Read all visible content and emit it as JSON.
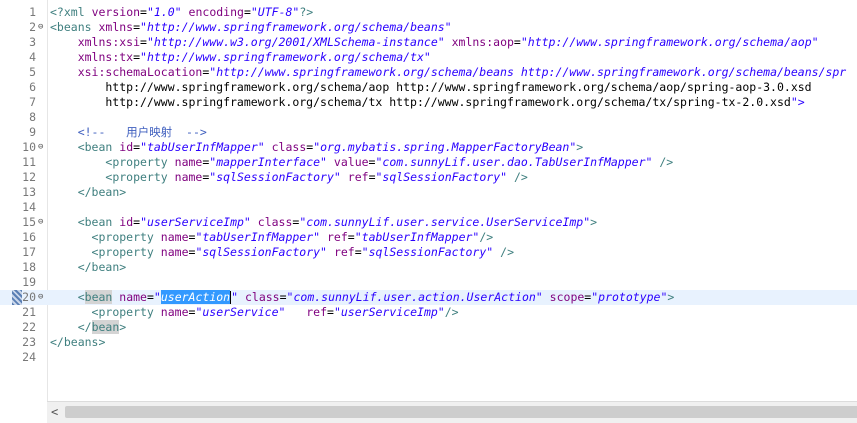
{
  "lines": [
    {
      "n": "1",
      "fold": "",
      "text": "<?xml version=\"1.0\" encoding=\"UTF-8\"?>"
    },
    {
      "n": "2",
      "fold": "⊖",
      "text": "<beans xmlns=\"http://www.springframework.org/schema/beans\""
    },
    {
      "n": "3",
      "fold": "",
      "text": "    xmlns:xsi=\"http://www.w3.org/2001/XMLSchema-instance\" xmlns:aop=\"http://www.springframework.org/schema/aop\""
    },
    {
      "n": "4",
      "fold": "",
      "text": "    xmlns:tx=\"http://www.springframework.org/schema/tx\""
    },
    {
      "n": "5",
      "fold": "",
      "text": "    xsi:schemaLocation=\"http://www.springframework.org/schema/beans http://www.springframework.org/schema/beans/spr"
    },
    {
      "n": "6",
      "fold": "",
      "text": "        http://www.springframework.org/schema/aop http://www.springframework.org/schema/aop/spring-aop-3.0.xsd"
    },
    {
      "n": "7",
      "fold": "",
      "text": "        http://www.springframework.org/schema/tx http://www.springframework.org/schema/tx/spring-tx-2.0.xsd\">"
    },
    {
      "n": "8",
      "fold": "",
      "text": ""
    },
    {
      "n": "9",
      "fold": "",
      "text": "    <!--   用户映射  -->"
    },
    {
      "n": "10",
      "fold": "⊖",
      "text": "    <bean id=\"tabUserInfMapper\" class=\"org.mybatis.spring.MapperFactoryBean\">"
    },
    {
      "n": "11",
      "fold": "",
      "text": "        <property name=\"mapperInterface\" value=\"com.sunnyLif.user.dao.TabUserInfMapper\" />"
    },
    {
      "n": "12",
      "fold": "",
      "text": "        <property name=\"sqlSessionFactory\" ref=\"sqlSessionFactory\" />"
    },
    {
      "n": "13",
      "fold": "",
      "text": "    </bean>"
    },
    {
      "n": "14",
      "fold": "",
      "text": ""
    },
    {
      "n": "15",
      "fold": "⊖",
      "text": "    <bean id=\"userServiceImp\" class=\"com.sunnyLif.user.service.UserServiceImp\">"
    },
    {
      "n": "16",
      "fold": "",
      "text": "      <property name=\"tabUserInfMapper\" ref=\"tabUserInfMapper\"/>"
    },
    {
      "n": "17",
      "fold": "",
      "text": "      <property name=\"sqlSessionFactory\" ref=\"sqlSessionFactory\" />"
    },
    {
      "n": "18",
      "fold": "",
      "text": "    </bean>"
    },
    {
      "n": "19",
      "fold": "",
      "text": ""
    },
    {
      "n": "20",
      "fold": "⊖",
      "text": "    <bean name=\"userAction\" class=\"com.sunnyLif.user.action.UserAction\" scope=\"prototype\">"
    },
    {
      "n": "21",
      "fold": "",
      "text": "      <property name=\"userService\"   ref=\"userServiceImp\"/>"
    },
    {
      "n": "22",
      "fold": "",
      "text": "    </bean>"
    },
    {
      "n": "23",
      "fold": "",
      "text": "</beans>"
    },
    {
      "n": "24",
      "fold": "",
      "text": ""
    }
  ],
  "current_line": "20",
  "selected_text": "userAction",
  "scrollbar": {
    "left_arrow": "<"
  },
  "colors": {
    "tag": "#3f7f7f",
    "attribute": "#7f007f",
    "value": "#2a00ff",
    "comment": "#3f5fbf",
    "selection": "#3399ff",
    "current_line": "#e8f2fe"
  }
}
